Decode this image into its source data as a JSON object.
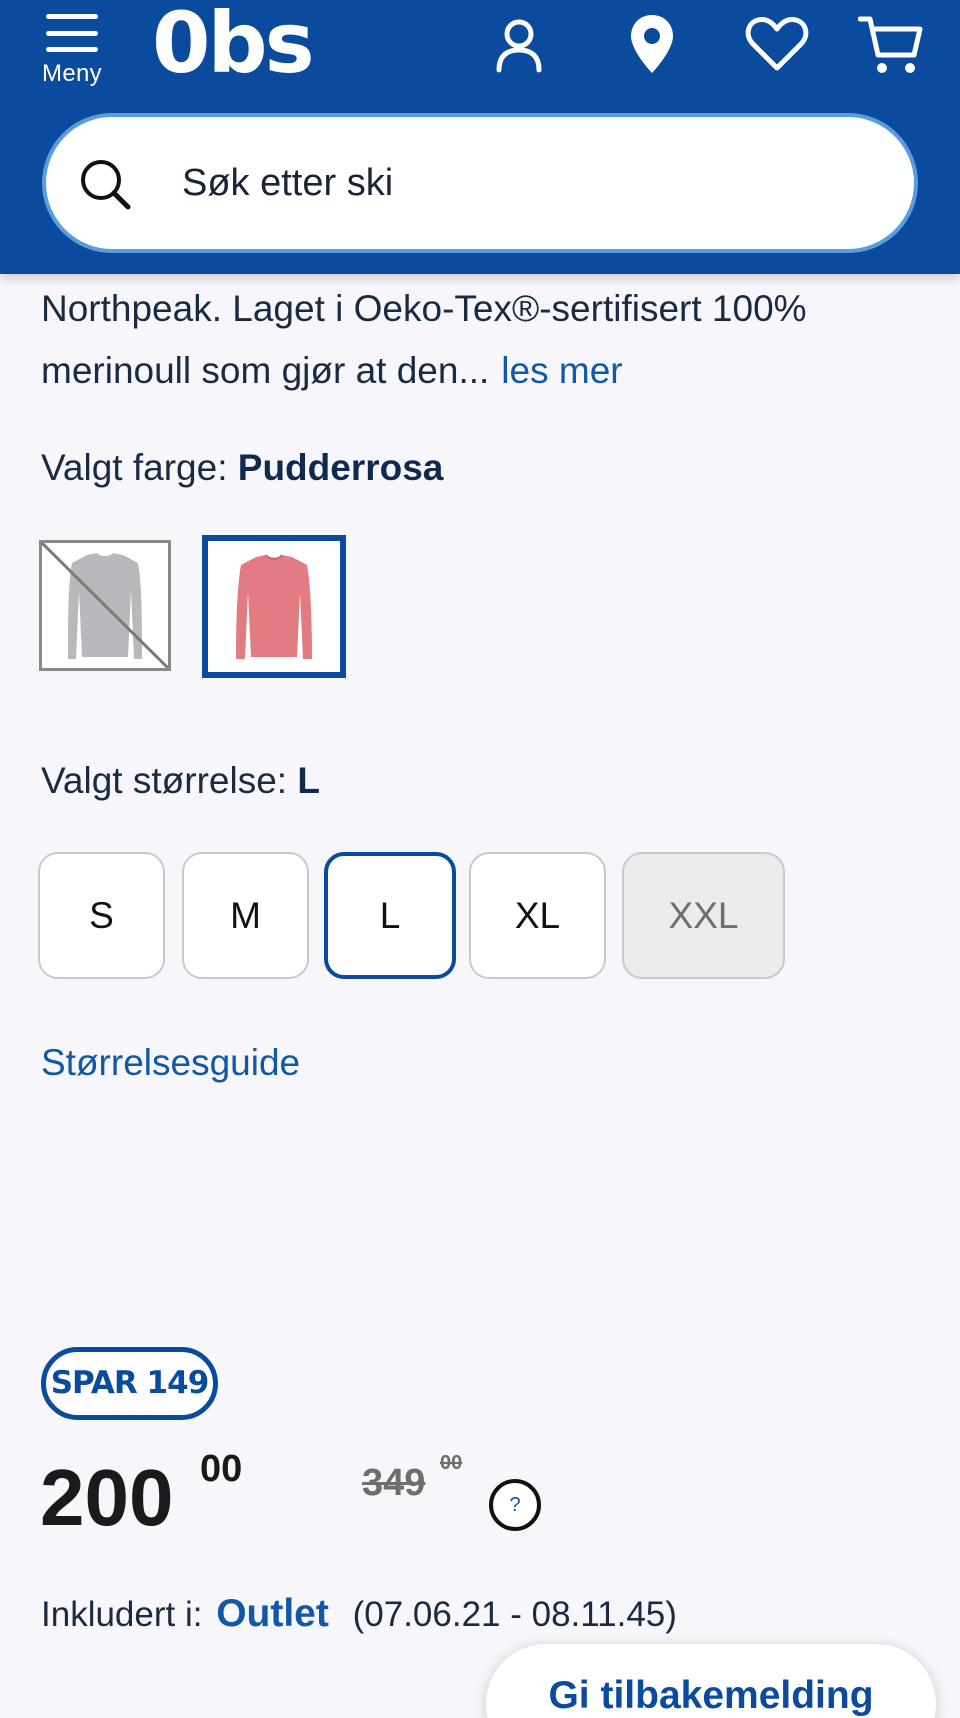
{
  "header": {
    "menu_label": "Meny",
    "logo_text": "0bs",
    "background_color": "#0a4b9d",
    "icons": [
      "user-icon",
      "location-pin-icon",
      "heart-icon",
      "cart-icon"
    ]
  },
  "search": {
    "placeholder": "Søk etter ski"
  },
  "product": {
    "description": "Northpeak. Laget i Oeko-Tex®-sertifisert 100% merinoull som gjør at den...",
    "read_more": "les mer",
    "color_label": "Valgt farge:",
    "color_value": "Pudderrosa",
    "color_options": [
      {
        "name": "grey",
        "available": false,
        "color": "#b9b9bd"
      },
      {
        "name": "Pudderrosa",
        "available": true,
        "selected": true,
        "color": "#e27c82"
      }
    ],
    "size_label": "Valgt størrelse:",
    "size_value": "L",
    "sizes": [
      {
        "label": "S",
        "available": true,
        "selected": false
      },
      {
        "label": "M",
        "available": true,
        "selected": false
      },
      {
        "label": "L",
        "available": true,
        "selected": true
      },
      {
        "label": "XL",
        "available": true,
        "selected": false
      },
      {
        "label": "XXL",
        "available": false,
        "selected": false
      }
    ],
    "size_guide": "Størrelsesguide"
  },
  "pricing": {
    "badge": "SPAR 149",
    "price_whole": "200",
    "price_decimals": "00",
    "old_price_whole": "349",
    "old_price_decimals": "00",
    "help": "?"
  },
  "campaign": {
    "label": "Inkludert i:",
    "name": "Outlet",
    "period": "(07.06.21 - 08.11.45)"
  },
  "feedback_button": "Gi tilbakemelding"
}
